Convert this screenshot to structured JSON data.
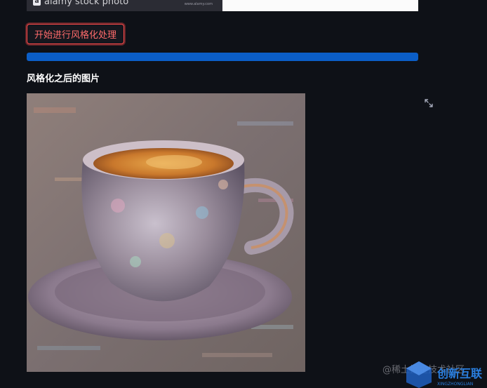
{
  "header_image": {
    "logo_mark": "a",
    "logo_text": "alamy stock photo",
    "url_text": "www.alamy.com"
  },
  "actions": {
    "stylize_button_label": "开始进行风格化处理"
  },
  "progress": {
    "value_percent": 100,
    "color": "#0b5ec7"
  },
  "result": {
    "subheader": "风格化之后的图片"
  },
  "icons": {
    "fullscreen": "expand-arrows-icon"
  },
  "watermark": {
    "text": "@稀土掘金技术社区",
    "logo_text": "创新互联",
    "logo_sub": "XINGZHONGLIAN"
  },
  "colors": {
    "background": "#0e1117",
    "accent": "#ff4b4b",
    "progress": "#0b5ec7"
  }
}
